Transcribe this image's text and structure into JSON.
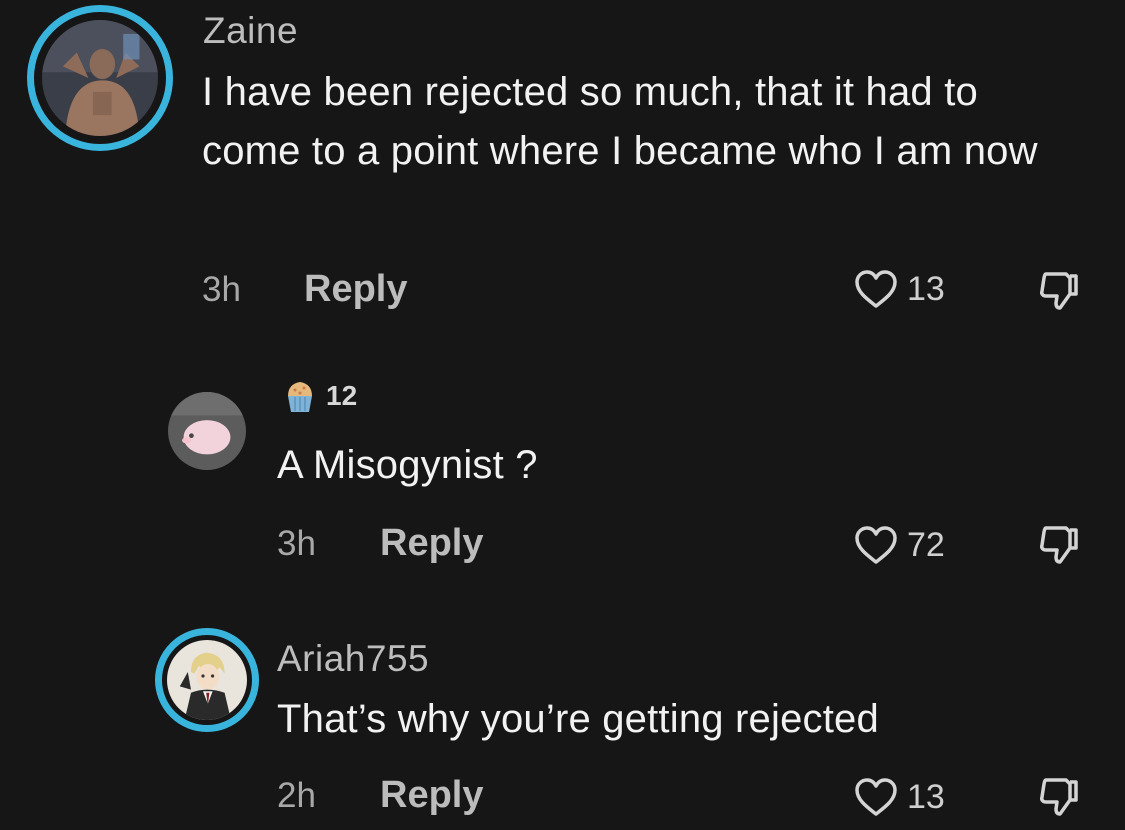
{
  "comments": [
    {
      "username": "Zaine",
      "text": "I have been rejected so much, that it had to come to a point where I became who I am now",
      "time": "3h",
      "reply_label": "Reply",
      "likes": "13"
    },
    {
      "username": "",
      "badge_icon": "cupcake-icon",
      "badge_count": "12",
      "text": "A Misogynist ?",
      "time": "3h",
      "reply_label": "Reply",
      "likes": "72"
    },
    {
      "username": "Ariah755",
      "text": "That’s why you’re getting rejected",
      "time": "2h",
      "reply_label": "Reply",
      "likes": "13"
    }
  ],
  "colors": {
    "background": "#161616",
    "story_ring": "#38b4dd",
    "text": "#f2f2f2",
    "muted": "#a8a8a8"
  },
  "icons": {
    "like": "heart-outline-icon",
    "dislike": "thumbs-down-icon"
  }
}
